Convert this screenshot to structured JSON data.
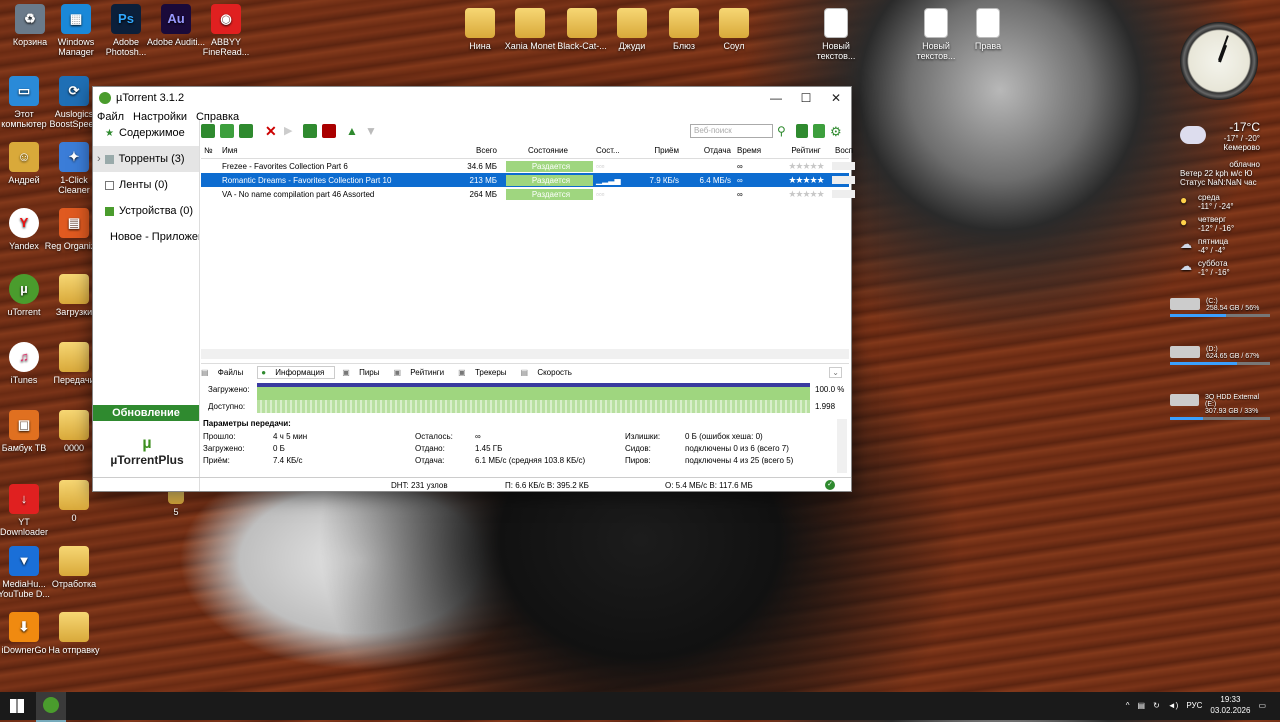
{
  "desktop": {
    "icons": [
      {
        "label": "Корзина",
        "x": 0
      },
      {
        "label": "Windows Manager"
      },
      {
        "label": "Adobe Photosh..."
      },
      {
        "label": "Adobe Auditi..."
      },
      {
        "label": "ABBYY FineRead..."
      },
      {
        "label": "Нина"
      },
      {
        "label": "Xania Monet"
      },
      {
        "label": "Black-Cat-..."
      },
      {
        "label": "Джуди"
      },
      {
        "label": "Блюз"
      },
      {
        "label": "Соул"
      },
      {
        "label": "Новый текстов..."
      },
      {
        "label": "Новый текстов..."
      },
      {
        "label": "Права"
      },
      {
        "label": "Этот компьютер"
      },
      {
        "label": "Auslogics BoostSpeed"
      },
      {
        "label": "Андрей"
      },
      {
        "label": "1-Click Cleaner"
      },
      {
        "label": "Yandex"
      },
      {
        "label": "Reg Organizer"
      },
      {
        "label": "uTorrent"
      },
      {
        "label": "Загрузки"
      },
      {
        "label": "iTunes"
      },
      {
        "label": "Передачи"
      },
      {
        "label": "Бамбук ТВ"
      },
      {
        "label": "0000"
      },
      {
        "label": "YT Downloader"
      },
      {
        "label": "0"
      },
      {
        "label": "5"
      },
      {
        "label": "MediaHu... YouTube D..."
      },
      {
        "label": "Отработка"
      },
      {
        "label": "iDownerGo"
      },
      {
        "label": "На отправку"
      }
    ]
  },
  "window": {
    "title": "µTorrent 3.1.2",
    "menu": [
      "Файл",
      "Настройки",
      "Справка"
    ],
    "sidebar": {
      "items": [
        "Содержимое",
        "Торренты (3)",
        "Ленты (0)",
        "Устройства (0)",
        "Новое - Приложения"
      ],
      "update_button": "Обновление",
      "plus_logo": "µTorrentPlus"
    },
    "toolbar": {
      "search_placeholder": "Веб-поиск"
    },
    "columns": [
      "№",
      "Имя",
      "Всего",
      "Состояние",
      "Сост...",
      "Приём",
      "Отдача",
      "Время",
      "Рейтинг",
      "Восп"
    ],
    "torrents": [
      {
        "name": "Frezee - Favorites Collection Part 6",
        "size": "34.6 МБ",
        "status": "Раздается",
        "down": "",
        "up": "",
        "time": "∞",
        "rating": "★★★★★"
      },
      {
        "name": "Romantic Dreams - Favorites Collection Part 10",
        "size": "213 МБ",
        "status": "Раздается",
        "down": "7.9 КБ/s",
        "up": "6.4 МБ/s",
        "time": "∞",
        "rating": "★★★★★"
      },
      {
        "name": "VA - No name compilation part 46 Assorted",
        "size": "264 МБ",
        "status": "Раздается",
        "down": "",
        "up": "",
        "time": "∞",
        "rating": "★★★★★"
      }
    ],
    "tabs": [
      "Файлы",
      "Информация",
      "Пиры",
      "Рейтинги",
      "Трекеры",
      "Скорость"
    ],
    "info": {
      "downloaded_label": "Загружено:",
      "downloaded_value": "100.0 %",
      "availability_label": "Доступно:",
      "availability_value": "1.998"
    },
    "params": {
      "title": "Параметры передачи:",
      "rows": [
        [
          "Прошло:",
          "4 ч 5 мин",
          "Осталось:",
          "∞",
          "Излишки:",
          "0 Б (ошибок хеша: 0)"
        ],
        [
          "Загружено:",
          "0 Б",
          "Отдано:",
          "1.45 ГБ",
          "Сидов:",
          "подключены 0 из 6 (всего 7)"
        ],
        [
          "Приём:",
          "7.4 КБ/с",
          "Отдача:",
          "6.1 МБ/с (средняя 103.8 КБ/с)",
          "Пиров:",
          "подключены 4 из 25 (всего 5)"
        ]
      ]
    },
    "statusbar": {
      "dht": "DHT: 231 узлов",
      "down": "П: 6.6 КБ/с В: 395.2 КБ",
      "up": "О: 5.4 МБ/с В: 117.6 МБ"
    }
  },
  "weather": {
    "temp": "-17°C",
    "range": "-17° / -20°",
    "city": "Кемерово",
    "condition": "облачно",
    "wind_label": "Ветер",
    "wind": "22 kph м/с Ю",
    "status_label": "Статус",
    "status": "NaN:NaN час",
    "forecast": [
      {
        "day": "среда",
        "temp": "-11° / -24°"
      },
      {
        "day": "четверг",
        "temp": "-12° / -16°"
      },
      {
        "day": "пятница",
        "temp": "-4° / -4°"
      },
      {
        "day": "суббота",
        "temp": "-1° / -16°"
      }
    ]
  },
  "drives": [
    {
      "name": "(C:)",
      "info": "258.54 GB / 56%",
      "fill_pct": 56
    },
    {
      "name": "(D:)",
      "info": "624.65 GB / 67%",
      "fill_pct": 67
    },
    {
      "name": "3Q HDD External (E:)",
      "info": "307.93 GB / 33%",
      "fill_pct": 33
    }
  ],
  "taskbar": {
    "lang": "РУС",
    "time": "19:33",
    "date": "03.02.2026"
  },
  "colors": {
    "accent": "#0d6cd0",
    "status_green": "#9fd67f",
    "brand_green": "#2f8a2f"
  }
}
